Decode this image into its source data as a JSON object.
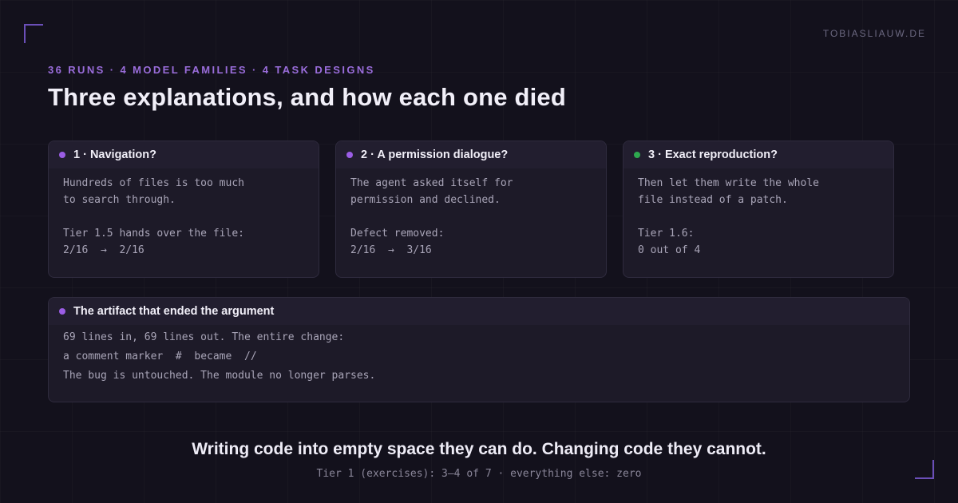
{
  "site": "TOBIASLIAUW.DE",
  "eyebrow": "36 RUNS · 4 MODEL FAMILIES · 4 TASK DESIGNS",
  "title": "Three explanations, and how each one died",
  "colors": {
    "accent": "#9a6ddb",
    "dot_purple": "#9b5de5",
    "dot_green": "#2ea84f"
  },
  "cards": [
    {
      "title": "1 · Navigation?",
      "dot": "purple",
      "lines": [
        "Hundreds of files is too much",
        "to search through.",
        "",
        "Tier 1.5 hands over the file:"
      ],
      "from": "2/16",
      "arrow": "→",
      "to": "2/16"
    },
    {
      "title": "2 · A permission dialogue?",
      "dot": "purple",
      "lines": [
        "The agent asked itself for",
        "permission and declined.",
        "",
        "Defect removed:"
      ],
      "from": "2/16",
      "arrow": "→",
      "to": "3/16"
    },
    {
      "title": "3 · Exact reproduction?",
      "dot": "green",
      "lines": [
        "Then let them write the whole",
        "file instead of a patch.",
        "",
        "Tier 1.6:",
        "0 out of 4"
      ]
    }
  ],
  "artifact": {
    "title": "The artifact that ended the argument",
    "line1": "69 lines in, 69 lines out. The entire change:",
    "line2_prefix": "a comment marker",
    "old_marker": "#",
    "became": "became",
    "new_marker": "//",
    "line3": "The bug is untouched. The module no longer parses."
  },
  "tagline": "Writing code into empty space they can do. Changing code they cannot.",
  "subline": "Tier 1 (exercises): 3–4 of 7 · everything else: zero"
}
